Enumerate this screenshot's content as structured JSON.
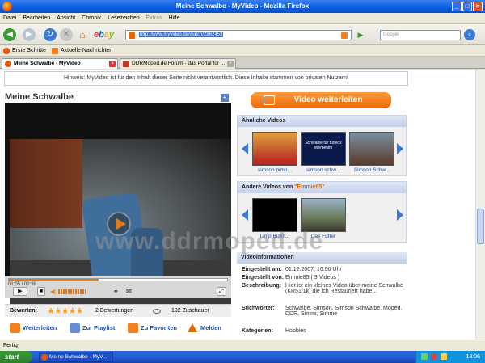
{
  "window": {
    "title": "Meine Schwalbe - MyVideo - Mozilla Firefox"
  },
  "menu": [
    "Datei",
    "Bearbeiten",
    "Ansicht",
    "Chronik",
    "Lesezeichen",
    "Extras",
    "Hilfe"
  ],
  "nav": {
    "url": "http://www.myvideo.de/watch/2862453",
    "search_placeholder": "Google"
  },
  "bookmarks": [
    "Erste Schritte",
    "Aktuelle Nachrichten"
  ],
  "tabs": [
    {
      "label": "Meine Schwalbe - MyVideo",
      "active": true
    },
    {
      "label": "DDRMoped.de Forum - das Portal für ...",
      "active": false
    }
  ],
  "page": {
    "hint": "Hinweis: MyVideo ist für den Inhalt dieser Seite nicht verantwortlich. Diese Inhalte stammen von privaten Nutzern!",
    "video_title": "Meine Schwalbe",
    "timecode": "01:05 / 02:38",
    "progress": 0.41,
    "rating_label": "Bewerten:",
    "stars": 5,
    "ratings_count": "2 Bewertungen",
    "views": "192 Zuschauer",
    "actions": [
      "Weiterleiten",
      "Zur Playlist",
      "Zu Favoriten",
      "Melden"
    ],
    "forward_button": "Video weiterleiten",
    "similar": {
      "title": "Ähnliche Videos",
      "items": [
        "simson pimp...",
        "simson schw...",
        "Simson Schw..."
      ],
      "thumb_text": "Schwalbe für tuneds Werbefilm"
    },
    "other": {
      "title_prefix": "Andere Videos von",
      "user": "\"Emmie85\"",
      "items": [
        "Limp Bizkit...",
        "Das Futter"
      ]
    },
    "info": {
      "title": "Videoinformationen",
      "eingestellt_am_label": "Eingestellt am:",
      "eingestellt_am": "01.12.2007, 16:56 Uhr",
      "eingestellt_von_label": "Eingestellt von:",
      "eingestellt_von": "Emmie85 ( 3 Videos )",
      "beschreibung_label": "Beschreibung:",
      "beschreibung": "Hier ist ein kleines Video über meine Schwalbe (KR51/1k) die ich Restauriert habe...",
      "stichwoerter_label": "Stichwörter:",
      "stichwoerter": "Schwalbe, Simson, Simson Schwalbe, Moped, DDR, Simmi, Simme",
      "kategorien_label": "Kategorien:",
      "kategorien": "Hobbies"
    },
    "watermark": "www.ddrmoped.de"
  },
  "status": "Fertig",
  "taskbar": {
    "start": "start",
    "item": "Meine Schwalbe - MyV...",
    "clock": "13:06"
  },
  "colors": {
    "accent_orange": "#ea6a08",
    "link_blue": "#1a4ea8",
    "xp_blue": "#245edc"
  }
}
